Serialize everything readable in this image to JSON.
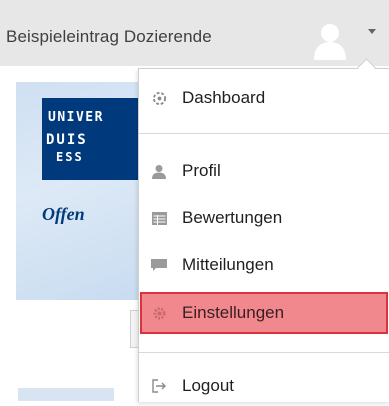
{
  "userbar": {
    "name": "Beispieleintrag Dozierende"
  },
  "background": {
    "logo_lines": [
      "UNIVER",
      "DUIS",
      "ESS"
    ],
    "tagline": "Offen"
  },
  "menu": {
    "items": [
      {
        "label": "Dashboard",
        "icon": "dashboard-icon"
      },
      {
        "label": "Profil",
        "icon": "user-icon"
      },
      {
        "label": "Bewertungen",
        "icon": "grades-icon"
      },
      {
        "label": "Mitteilungen",
        "icon": "message-icon"
      },
      {
        "label": "Einstellungen",
        "icon": "gear-icon",
        "highlighted": true
      },
      {
        "label": "Logout",
        "icon": "logout-icon"
      }
    ]
  },
  "colors": {
    "highlight_fill": "#f1888d",
    "highlight_border": "#d9343d",
    "logo_blue": "#003a7d"
  }
}
